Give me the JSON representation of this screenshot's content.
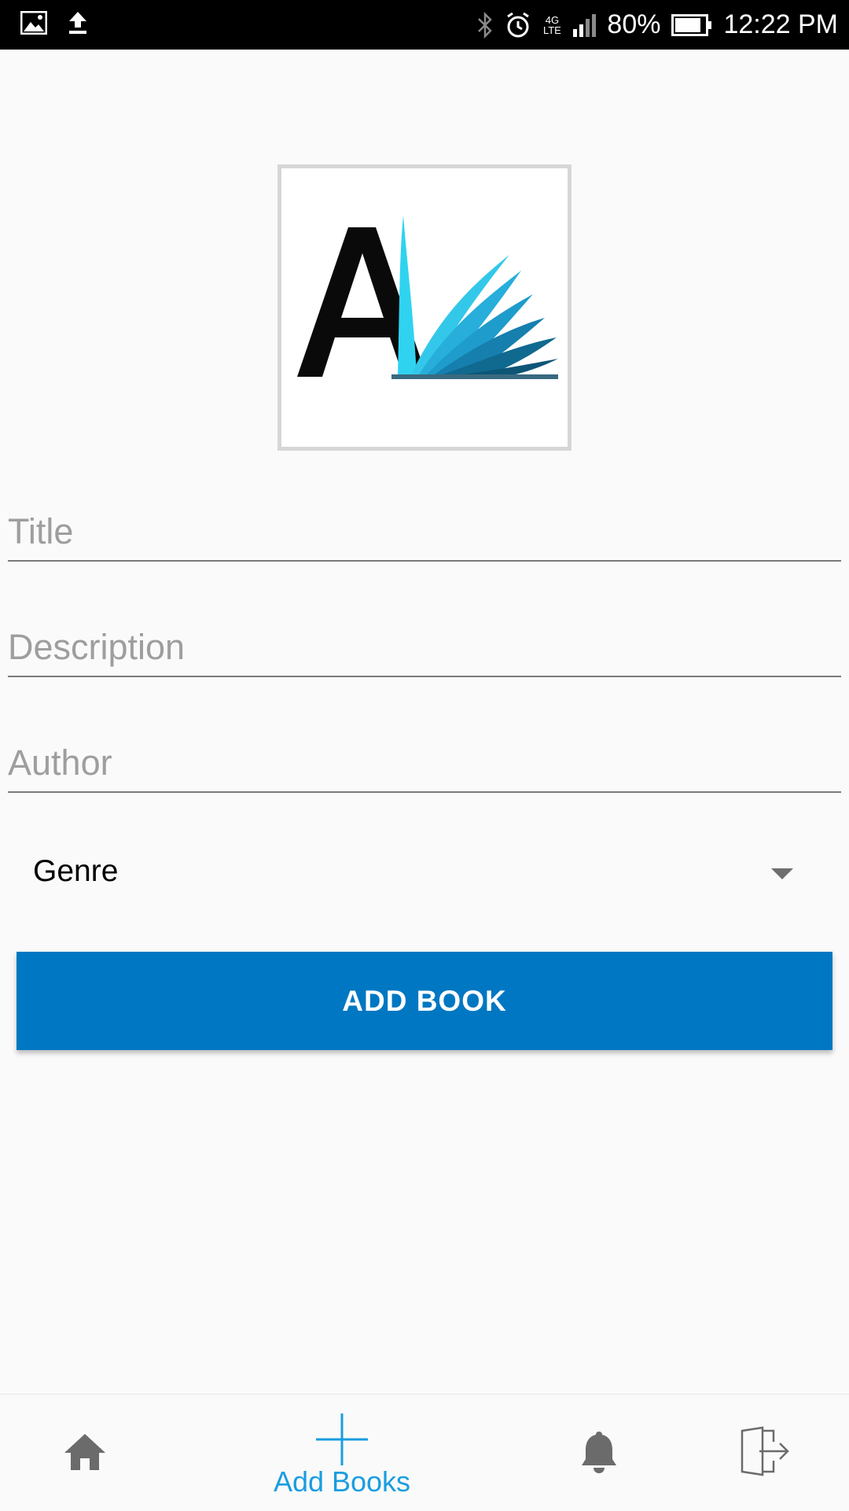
{
  "status_bar": {
    "battery": "80%",
    "time": "12:22 PM",
    "network": "4G LTE",
    "icons": [
      "image-icon",
      "upload-icon",
      "bluetooth-icon",
      "alarm-icon",
      "signal-icon",
      "battery-icon"
    ]
  },
  "logo": {
    "icon": "book-logo-icon"
  },
  "form": {
    "title_placeholder": "Title",
    "description_placeholder": "Description",
    "author_placeholder": "Author",
    "genre_selected": "Genre",
    "submit_label": "ADD BOOK"
  },
  "bottom_nav": {
    "items": [
      {
        "icon": "home-icon",
        "label": ""
      },
      {
        "icon": "plus-icon",
        "label": "Add Books",
        "active": true
      },
      {
        "icon": "bell-icon",
        "label": ""
      },
      {
        "icon": "logout-icon",
        "label": ""
      }
    ]
  },
  "colors": {
    "primary_button": "#0077c2",
    "active_nav": "#1a9de0",
    "status_bar": "#000000",
    "background": "#fafafa"
  }
}
